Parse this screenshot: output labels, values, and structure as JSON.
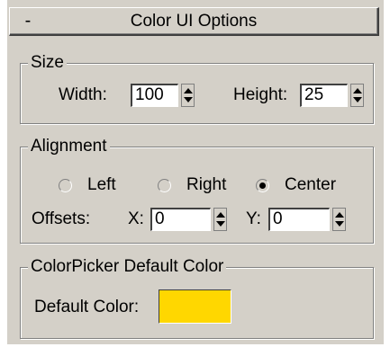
{
  "rollout": {
    "toggle": "-",
    "title": "Color UI Options"
  },
  "size": {
    "label": "Size",
    "width_label": "Width:",
    "width_value": "100",
    "height_label": "Height:",
    "height_value": "25"
  },
  "alignment": {
    "label": "Alignment",
    "options": [
      "Left",
      "Right",
      "Center"
    ],
    "selected": "Center",
    "offsets_label": "Offsets:",
    "x_label": "X:",
    "x_value": "0",
    "y_label": "Y:",
    "y_value": "0"
  },
  "colorpicker": {
    "label": "ColorPicker Default Color",
    "default_label": "Default Color:",
    "color": "#ffd700"
  },
  "colors": {
    "panel": "#d4d0c8",
    "highlight": "#ffffff",
    "shadow": "#808080"
  }
}
